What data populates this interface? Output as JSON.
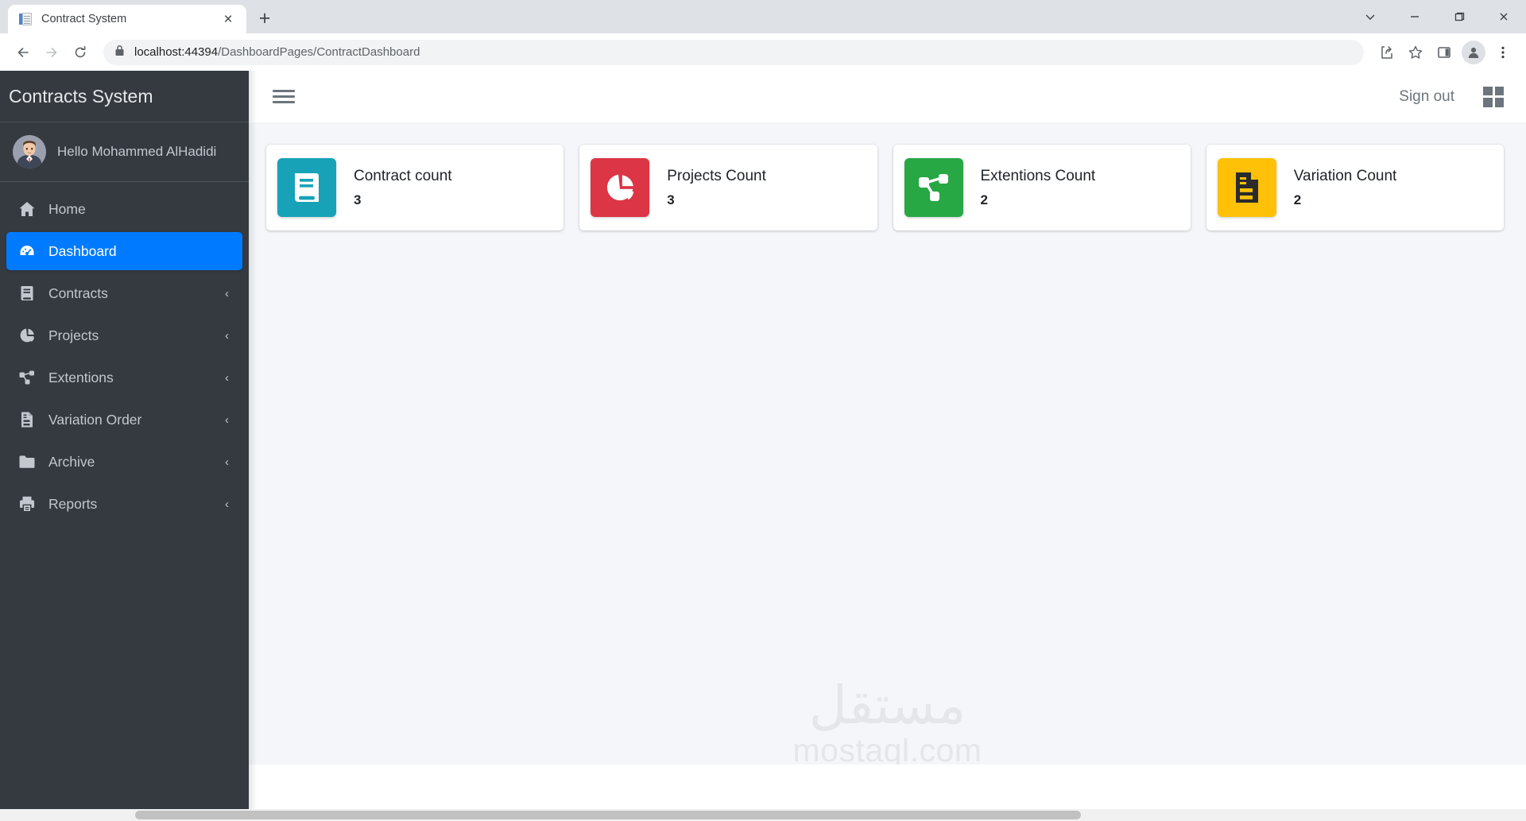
{
  "browser": {
    "tab": {
      "title": "Contract System",
      "favicon": "document-icon",
      "close": "×"
    },
    "newtab_label": "+",
    "window_controls": {
      "minimize": "minimize-icon",
      "maximize": "maximize-icon",
      "close": "close-icon",
      "chevron": "chevron-down-icon"
    },
    "toolbar": {
      "back": "back-arrow-icon",
      "forward": "forward-arrow-icon",
      "reload": "reload-icon",
      "lock": "lock-icon",
      "url_host": "localhost:44394",
      "url_path": "/DashboardPages/ContractDashboard",
      "url_full": "localhost:44394/DashboardPages/ContractDashboard",
      "share": "share-icon",
      "bookmark": "star-icon",
      "sidepanel": "side-panel-icon",
      "profile": "profile-avatar-icon",
      "menu": "three-dot-menu-icon"
    }
  },
  "sidebar": {
    "brand": "Contracts System",
    "user": {
      "greeting": "Hello Mohammed AlHadidi",
      "avatar": "user-avatar"
    },
    "items": [
      {
        "label": "Home",
        "icon": "home-icon",
        "active": false,
        "chevron": ""
      },
      {
        "label": "Dashboard",
        "icon": "dashboard-gauge-icon",
        "active": true,
        "chevron": ""
      },
      {
        "label": "Contracts",
        "icon": "book-icon",
        "active": false,
        "chevron": "‹"
      },
      {
        "label": "Projects",
        "icon": "pie-chart-icon",
        "active": false,
        "chevron": "‹"
      },
      {
        "label": "Extentions",
        "icon": "sitemap-icon",
        "active": false,
        "chevron": "‹"
      },
      {
        "label": "Variation Order",
        "icon": "file-document-icon",
        "active": false,
        "chevron": "‹"
      },
      {
        "label": "Archive",
        "icon": "folder-icon",
        "active": false,
        "chevron": "‹"
      },
      {
        "label": "Reports",
        "icon": "printer-icon",
        "active": false,
        "chevron": "‹"
      }
    ]
  },
  "navbar": {
    "menu_toggle": "hamburger-icon",
    "sign_out": "Sign out",
    "apps_grid": "grid-icon"
  },
  "cards": [
    {
      "title": "Contract count",
      "value": "3",
      "icon": "book-icon",
      "color": "#17a2b8"
    },
    {
      "title": "Projects Count",
      "value": "3",
      "icon": "pie-chart-icon",
      "color": "#dc3545"
    },
    {
      "title": "Extentions Count",
      "value": "2",
      "icon": "sitemap-icon",
      "color": "#28a745"
    },
    {
      "title": "Variation Count",
      "value": "2",
      "icon": "file-document-icon",
      "color": "#ffc107"
    }
  ],
  "watermark": {
    "arabic": "مستقل",
    "latin": "mostaql.com"
  }
}
